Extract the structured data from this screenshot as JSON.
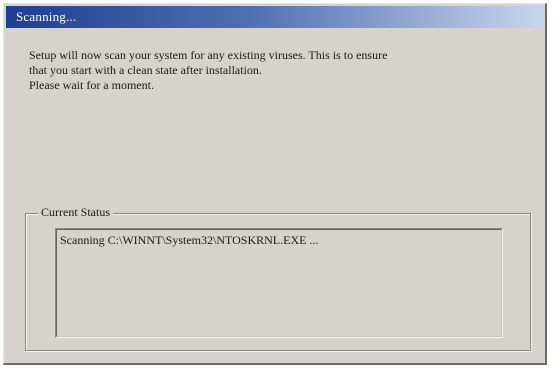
{
  "window": {
    "title": "Scanning..."
  },
  "message": {
    "lines": [
      "Setup will now scan your system for any existing viruses. This is to ensure",
      "that you start with a clean state after installation.",
      "Please wait for a moment."
    ]
  },
  "status_group": {
    "label": "Current Status",
    "status_text": "Scanning C:\\WINNT\\System32\\NTOSKRNL.EXE ..."
  },
  "colors": {
    "title_bar_start": "#1f3f8f",
    "title_bar_end": "#c9d5ec",
    "dialog_face": "#d6d3ce"
  }
}
